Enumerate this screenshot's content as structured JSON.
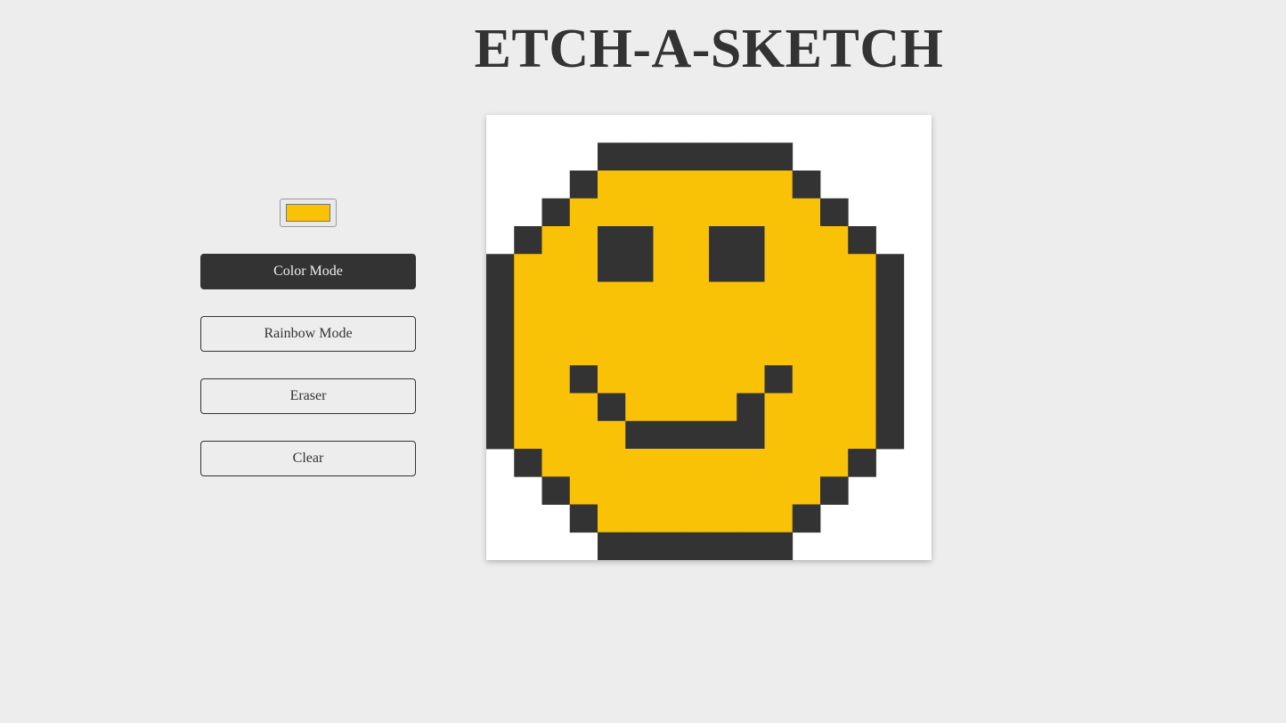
{
  "title": "ETCH-A-SKETCH",
  "color_picker": {
    "icon": "color-swatch",
    "value": "#f9c206"
  },
  "buttons": {
    "color_mode": "Color Mode",
    "rainbow_mode": "Rainbow Mode",
    "eraser": "Eraser",
    "clear": "Clear"
  },
  "active_mode": "color_mode",
  "colors": {
    "background": "#ededed",
    "ink": "#333333",
    "yellow": "#f9c206",
    "board": "#ffffff"
  },
  "grid": {
    "size": 16,
    "rows": [
      "................",
      "....KKKKKKK.....",
      "...KYYYYYYYK....",
      "..KYYYYYYYYYK...",
      ".KYYKKYYKKYYYK..",
      "KYYYKKYYKKYYYYK.",
      "KYYYYYYYYYYYYYK.",
      "KYYYYYYYYYYYYYK.",
      "KYYYYYYYYYYYYYK.",
      "KYYKYYYYYYKYYYK.",
      "KYYYKYYYYKYYYYK.",
      "KYYYYKKKKKYYYYK.",
      ".KYYYYYYYYYYYK..",
      "..KYYYYYYYYYK...",
      "...KYYYYYYYK....",
      "....KKKKKKK....."
    ],
    "legend": {
      "K": "#333333",
      "Y": "#f9c206"
    }
  }
}
